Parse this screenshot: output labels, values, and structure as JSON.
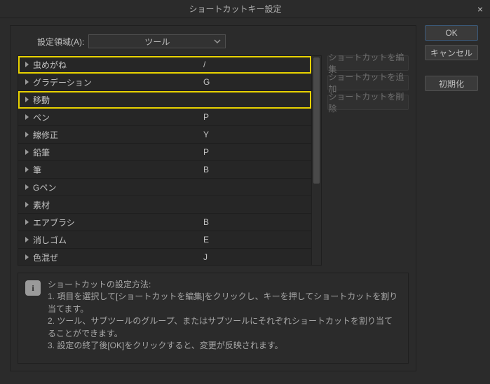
{
  "title": "ショートカットキー設定",
  "area": {
    "label": "設定領域(A):",
    "value": "ツール"
  },
  "list": [
    {
      "label": "虫めがね",
      "shortcut": "/",
      "highlight": true
    },
    {
      "label": "グラデーション",
      "shortcut": "G",
      "highlight": false
    },
    {
      "label": "移動",
      "shortcut": "",
      "highlight": true
    },
    {
      "label": "ペン",
      "shortcut": "P",
      "highlight": false
    },
    {
      "label": "線修正",
      "shortcut": "Y",
      "highlight": false
    },
    {
      "label": "鉛筆",
      "shortcut": "P",
      "highlight": false
    },
    {
      "label": "筆",
      "shortcut": "B",
      "highlight": false
    },
    {
      "label": "Gペン",
      "shortcut": "",
      "highlight": false
    },
    {
      "label": "素材",
      "shortcut": "",
      "highlight": false
    },
    {
      "label": "エアブラシ",
      "shortcut": "B",
      "highlight": false
    },
    {
      "label": "消しゴム",
      "shortcut": "E",
      "highlight": false
    },
    {
      "label": "色混ぜ",
      "shortcut": "J",
      "highlight": false
    }
  ],
  "side": {
    "edit": "ショートカットを編集",
    "add": "ショートカットを追加",
    "delete": "ショートカットを削除"
  },
  "right": {
    "ok": "OK",
    "cancel": "キャンセル",
    "reset": "初期化"
  },
  "help": {
    "title": "ショートカットの設定方法:",
    "line1": "1. 項目を選択して[ショートカットを編集]をクリックし、キーを押してショートカットを割り当てます。",
    "line2": "2. ツール、サブツールのグループ、またはサブツールにそれぞれショートカットを割り当てることができます。",
    "line3": "3. 設定の終了後[OK]をクリックすると、変更が反映されます。"
  }
}
